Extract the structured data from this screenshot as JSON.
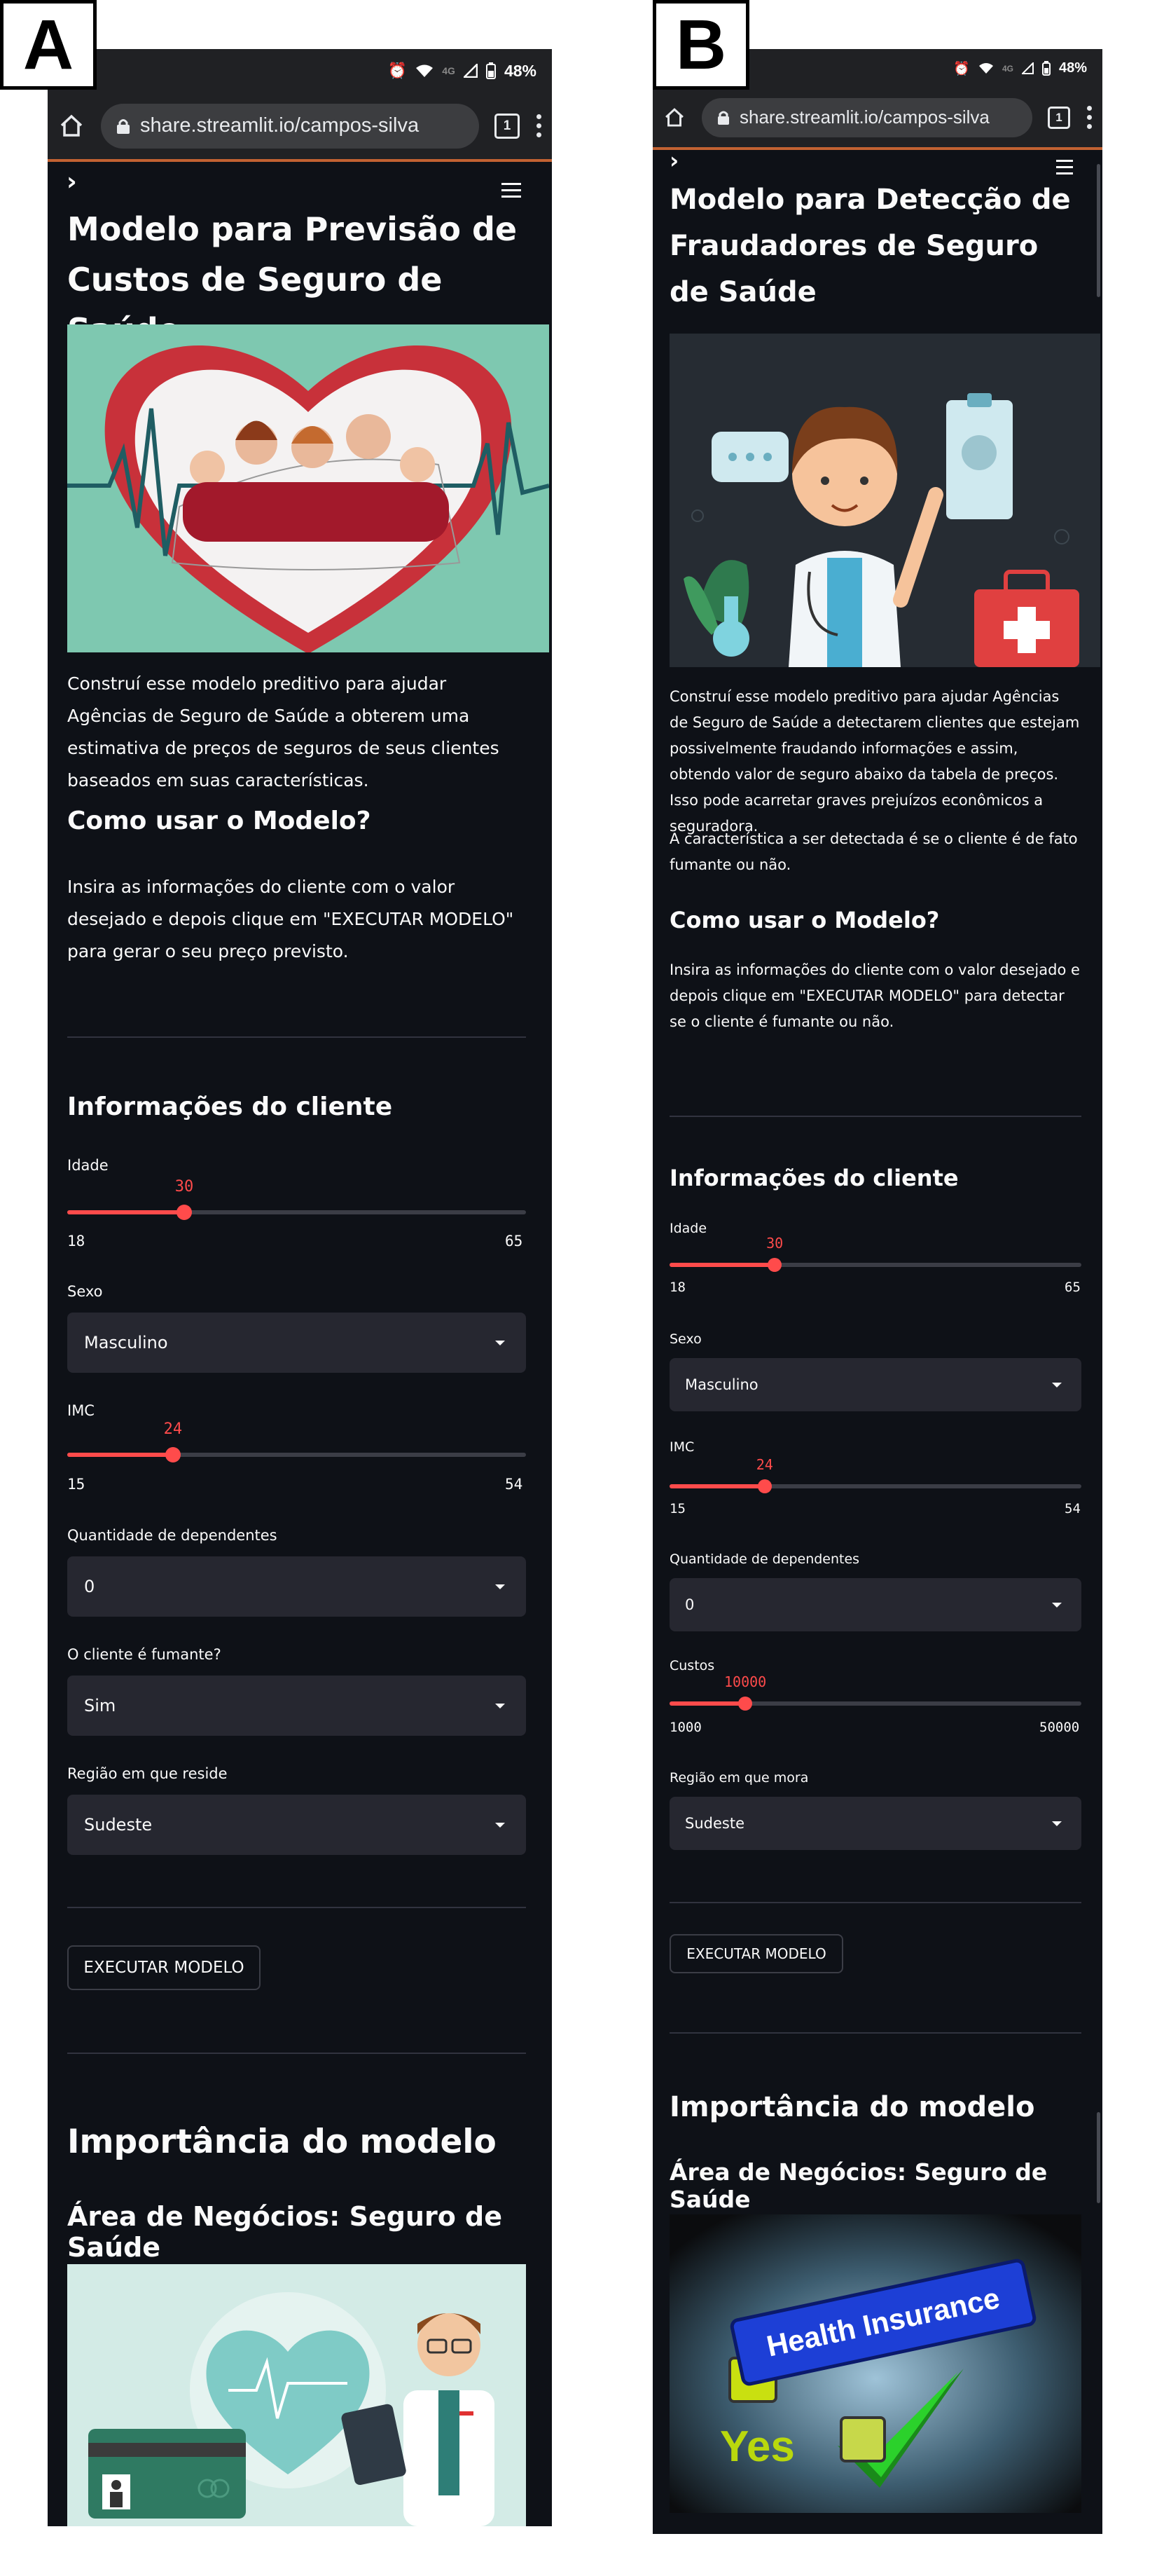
{
  "labels": {
    "a": "A",
    "b": "B"
  },
  "status": {
    "time_icon": "alarm-icon",
    "network": "4G",
    "battery": "48%"
  },
  "browser": {
    "url": "share.streamlit.io/campos-silva",
    "tabs": "1"
  },
  "panel_a": {
    "title": "Modelo para Previsão de Custos de Seguro de Saúde",
    "intro": "Construí esse modelo preditivo para ajudar Agências de Seguro de Saúde a obterem uma estimativa de preços de seguros de seus clientes baseados em suas características.",
    "howto_heading": "Como usar o Modelo?",
    "howto_text": "Insira as informações do cliente com o valor desejado e depois clique em \"EXECUTAR MODELO\" para gerar o seu preço previsto.",
    "client_heading": "Informações do cliente",
    "age": {
      "label": "Idade",
      "value": 30,
      "min": 18,
      "max": 65
    },
    "sex": {
      "label": "Sexo",
      "value": "Masculino"
    },
    "bmi": {
      "label": "IMC",
      "value": 24,
      "min": 15,
      "max": 54
    },
    "dependents": {
      "label": "Quantidade de dependentes",
      "value": "0"
    },
    "smoker": {
      "label": "O cliente é fumante?",
      "value": "Sim"
    },
    "region": {
      "label": "Região em que reside",
      "value": "Sudeste"
    },
    "run_button": "EXECUTAR MODELO",
    "importance_heading": "Importância do modelo",
    "business_heading": "Área de Negócios: Seguro de Saúde"
  },
  "panel_b": {
    "title": "Modelo para Detecção de Fraudadores de Seguro de Saúde",
    "intro": "Construí esse modelo preditivo para ajudar Agências de Seguro de Saúde a detectarem clientes que estejam possivelmente fraudando informações e assim, obtendo valor de seguro abaixo da tabela de preços. Isso pode acarretar graves prejuízos econômicos a seguradora.",
    "intro2": "A característica a ser detectada é se o cliente é de fato fumante ou não.",
    "howto_heading": "Como usar o Modelo?",
    "howto_text": "Insira as informações do cliente com o valor desejado e depois clique em \"EXECUTAR MODELO\" para detectar se o cliente é fumante ou não.",
    "client_heading": "Informações do cliente",
    "age": {
      "label": "Idade",
      "value": 30,
      "min": 18,
      "max": 65
    },
    "sex": {
      "label": "Sexo",
      "value": "Masculino"
    },
    "bmi": {
      "label": "IMC",
      "value": 24,
      "min": 15,
      "max": 54
    },
    "dependents": {
      "label": "Quantidade de dependentes",
      "value": "0"
    },
    "costs": {
      "label": "Custos",
      "value": 10000,
      "min": 1000,
      "max": 50000
    },
    "region": {
      "label": "Região em que mora",
      "value": "Sudeste"
    },
    "run_button": "EXECUTAR MODELO",
    "importance_heading": "Importância do modelo",
    "business_heading": "Área de Negócios: Seguro de Saúde",
    "insurance_image_text": {
      "line1": "Health Insurance",
      "line2": "Yes"
    }
  },
  "colors": {
    "background": "#0e1117",
    "accent": "#ff4b4b",
    "input": "#262730"
  }
}
